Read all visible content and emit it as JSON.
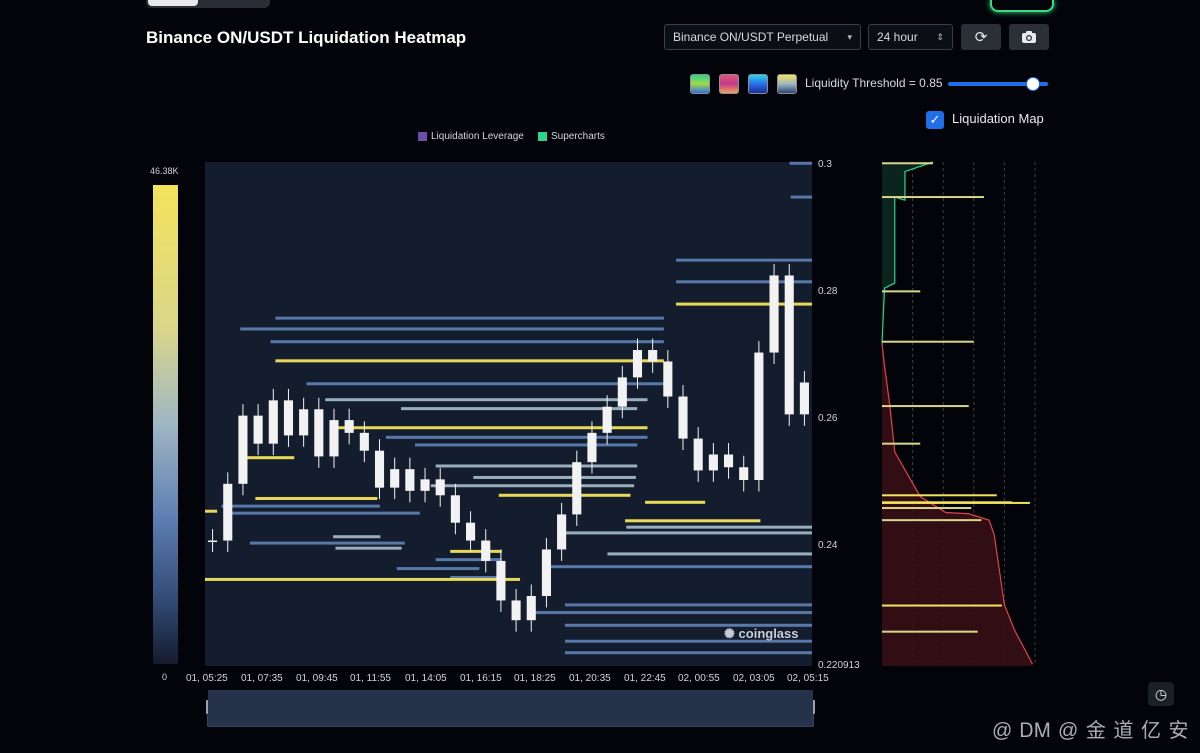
{
  "header": {
    "title": "Binance ON/USDT Liquidation Heatmap",
    "pair_select": "Binance ON/USDT Perpetual",
    "range_select": "24 hour",
    "threshold_label": "Liquidity Threshold = 0.85",
    "threshold_value": 0.85,
    "liquidation_map_label": "Liquidation Map",
    "liquidation_map_checked": true
  },
  "icons": {
    "refresh": "refresh-icon",
    "camera": "camera-icon",
    "clock": "clock-icon",
    "pair_caret": "chevron-down-icon",
    "range_caret": "updown-icon"
  },
  "palettes": [
    "#2ad48a",
    "#e0557a",
    "#2a6de8",
    "#e6c86a"
  ],
  "colors": {
    "background": "#020409",
    "plot_bg": "#141d2d",
    "heat_high": "#f3e35c",
    "heat_mid": "#9fb6c4",
    "heat_low": "#5c7db0",
    "candle": "#f2f2f2",
    "accent": "#1e6fe8",
    "long_cum": "#2ad48a",
    "short_cum": "#e0434a"
  },
  "watermark": "coinglass",
  "footer_watermark": "@ ᎠᎷ @ 金 道 亿 安",
  "chart_data": {
    "type": "heatmap",
    "legend": [
      {
        "name": "Liquidation Leverage",
        "color": "#6b4fa8"
      },
      {
        "name": "Supercharts",
        "color": "#2ad48a"
      }
    ],
    "colorbar": {
      "max_label": "46.38K",
      "min_label": "0",
      "max": 46380,
      "min": 0
    },
    "y_axis": {
      "min": 0.220913,
      "max": 0.3,
      "ticks": [
        "0.3",
        "0.28",
        "0.26",
        "0.24",
        "0.220913"
      ],
      "tick_values": [
        0.3,
        0.28,
        0.26,
        0.24,
        0.220913
      ]
    },
    "x_axis": {
      "ticks": [
        "01, 05:25",
        "01, 07:35",
        "01, 09:45",
        "01, 11:55",
        "01, 14:05",
        "01, 16:15",
        "01, 18:25",
        "01, 20:35",
        "01, 22:45",
        "02, 00:55",
        "02, 03:05",
        "02, 05:15"
      ]
    },
    "price_series": [
      0.2406,
      0.2495,
      0.2602,
      0.2558,
      0.2626,
      0.2571,
      0.2612,
      0.2538,
      0.2595,
      0.2575,
      0.2547,
      0.2489,
      0.2518,
      0.2484,
      0.2502,
      0.2477,
      0.2434,
      0.2406,
      0.2374,
      0.2312,
      0.2281,
      0.2319,
      0.2392,
      0.2447,
      0.2529,
      0.2575,
      0.2616,
      0.2662,
      0.2705,
      0.2687,
      0.2632,
      0.2566,
      0.2516,
      0.2541,
      0.2521,
      0.2501,
      0.2701,
      0.2822,
      0.2604,
      0.2654
    ],
    "liquidation_levels": [
      {
        "price": 0.2998,
        "x0": 0.963,
        "x1": 1.0,
        "intensity": 0.5
      },
      {
        "price": 0.2945,
        "x0": 0.965,
        "x1": 1.0,
        "intensity": 0.45
      },
      {
        "price": 0.2846,
        "x0": 0.776,
        "x1": 1.0,
        "intensity": 0.5
      },
      {
        "price": 0.2812,
        "x0": 0.776,
        "x1": 1.0,
        "intensity": 0.45
      },
      {
        "price": 0.2777,
        "x0": 0.776,
        "x1": 1.0,
        "intensity": 1.0
      },
      {
        "price": 0.2755,
        "x0": 0.116,
        "x1": 0.756,
        "intensity": 0.45
      },
      {
        "price": 0.2738,
        "x0": 0.058,
        "x1": 0.756,
        "intensity": 0.5
      },
      {
        "price": 0.2718,
        "x0": 0.108,
        "x1": 0.756,
        "intensity": 0.45
      },
      {
        "price": 0.2688,
        "x0": 0.116,
        "x1": 0.756,
        "intensity": 1.0
      },
      {
        "price": 0.2652,
        "x0": 0.167,
        "x1": 0.756,
        "intensity": 0.5
      },
      {
        "price": 0.2627,
        "x0": 0.198,
        "x1": 0.729,
        "intensity": 0.55
      },
      {
        "price": 0.2613,
        "x0": 0.323,
        "x1": 0.712,
        "intensity": 0.6
      },
      {
        "price": 0.2583,
        "x0": 0.207,
        "x1": 0.729,
        "intensity": 1.0
      },
      {
        "price": 0.2568,
        "x0": 0.298,
        "x1": 0.729,
        "intensity": 0.5
      },
      {
        "price": 0.2556,
        "x0": 0.346,
        "x1": 0.712,
        "intensity": 0.45
      },
      {
        "price": 0.2536,
        "x0": 0.056,
        "x1": 0.147,
        "intensity": 1.0
      },
      {
        "price": 0.2523,
        "x0": 0.38,
        "x1": 0.712,
        "intensity": 0.55
      },
      {
        "price": 0.2505,
        "x0": 0.442,
        "x1": 0.71,
        "intensity": 0.7
      },
      {
        "price": 0.2492,
        "x0": 0.372,
        "x1": 0.707,
        "intensity": 0.6
      },
      {
        "price": 0.2477,
        "x0": 0.484,
        "x1": 0.701,
        "intensity": 1.0
      },
      {
        "price": 0.2472,
        "x0": 0.083,
        "x1": 0.284,
        "intensity": 0.9
      },
      {
        "price": 0.2466,
        "x0": 0.725,
        "x1": 0.824,
        "intensity": 1.0
      },
      {
        "price": 0.246,
        "x0": 0.027,
        "x1": 0.288,
        "intensity": 0.45
      },
      {
        "price": 0.2452,
        "x0": 0.0,
        "x1": 0.02,
        "intensity": 1.0
      },
      {
        "price": 0.2449,
        "x0": 0.04,
        "x1": 0.354,
        "intensity": 0.5
      },
      {
        "price": 0.2437,
        "x0": 0.692,
        "x1": 0.915,
        "intensity": 1.0
      },
      {
        "price": 0.2427,
        "x0": 0.694,
        "x1": 1.0,
        "intensity": 0.6
      },
      {
        "price": 0.2418,
        "x0": 0.593,
        "x1": 1.0,
        "intensity": 0.6
      },
      {
        "price": 0.2412,
        "x0": 0.211,
        "x1": 0.289,
        "intensity": 0.55
      },
      {
        "price": 0.2402,
        "x0": 0.074,
        "x1": 0.329,
        "intensity": 0.45
      },
      {
        "price": 0.2394,
        "x0": 0.215,
        "x1": 0.324,
        "intensity": 0.55
      },
      {
        "price": 0.2389,
        "x0": 0.404,
        "x1": 0.489,
        "intensity": 1.0
      },
      {
        "price": 0.2385,
        "x0": 0.663,
        "x1": 1.0,
        "intensity": 0.6
      },
      {
        "price": 0.2376,
        "x0": 0.38,
        "x1": 0.489,
        "intensity": 0.5
      },
      {
        "price": 0.2365,
        "x0": 0.57,
        "x1": 1.0,
        "intensity": 0.45
      },
      {
        "price": 0.2362,
        "x0": 0.316,
        "x1": 0.452,
        "intensity": 0.45
      },
      {
        "price": 0.2348,
        "x0": 0.404,
        "x1": 0.494,
        "intensity": 0.5
      },
      {
        "price": 0.2345,
        "x0": 0.0,
        "x1": 0.519,
        "intensity": 1.0
      },
      {
        "price": 0.2305,
        "x0": 0.593,
        "x1": 1.0,
        "intensity": 0.45
      },
      {
        "price": 0.2293,
        "x0": 0.544,
        "x1": 1.0,
        "intensity": 0.5
      },
      {
        "price": 0.2273,
        "x0": 0.593,
        "x1": 1.0,
        "intensity": 0.45
      },
      {
        "price": 0.2248,
        "x0": 0.593,
        "x1": 1.0,
        "intensity": 0.5
      },
      {
        "price": 0.223,
        "x0": 0.593,
        "x1": 1.0,
        "intensity": 0.45
      }
    ],
    "liquidation_map": {
      "long_cumulative": [
        [
          0.3,
          0.4
        ],
        [
          0.2985,
          0.18
        ],
        [
          0.294,
          0.18
        ],
        [
          0.2945,
          0.1
        ],
        [
          0.281,
          0.1
        ],
        [
          0.2802,
          0.02
        ],
        [
          0.2715,
          0.0
        ]
      ],
      "short_cumulative": [
        [
          0.2715,
          0.0
        ],
        [
          0.268,
          0.02
        ],
        [
          0.262,
          0.06
        ],
        [
          0.2545,
          0.1
        ],
        [
          0.2475,
          0.3
        ],
        [
          0.245,
          0.5
        ],
        [
          0.2448,
          0.68
        ],
        [
          0.2438,
          0.84
        ],
        [
          0.2415,
          0.88
        ],
        [
          0.2305,
          0.96
        ],
        [
          0.2265,
          1.04
        ],
        [
          0.2235,
          1.12
        ],
        [
          0.2212,
          1.18
        ]
      ],
      "bars": [
        {
          "price": 0.2998,
          "value": 0.4
        },
        {
          "price": 0.2945,
          "value": 0.8
        },
        {
          "price": 0.2797,
          "value": 0.3
        },
        {
          "price": 0.2718,
          "value": 0.72
        },
        {
          "price": 0.2617,
          "value": 0.68
        },
        {
          "price": 0.2558,
          "value": 0.3
        },
        {
          "price": 0.2477,
          "value": 0.9
        },
        {
          "price": 0.2465,
          "value": 1.16
        },
        {
          "price": 0.2466,
          "value": 1.02
        },
        {
          "price": 0.2457,
          "value": 0.7
        },
        {
          "price": 0.2438,
          "value": 0.78
        },
        {
          "price": 0.2304,
          "value": 0.94
        },
        {
          "price": 0.2263,
          "value": 0.75
        }
      ],
      "max": 1.2
    }
  }
}
